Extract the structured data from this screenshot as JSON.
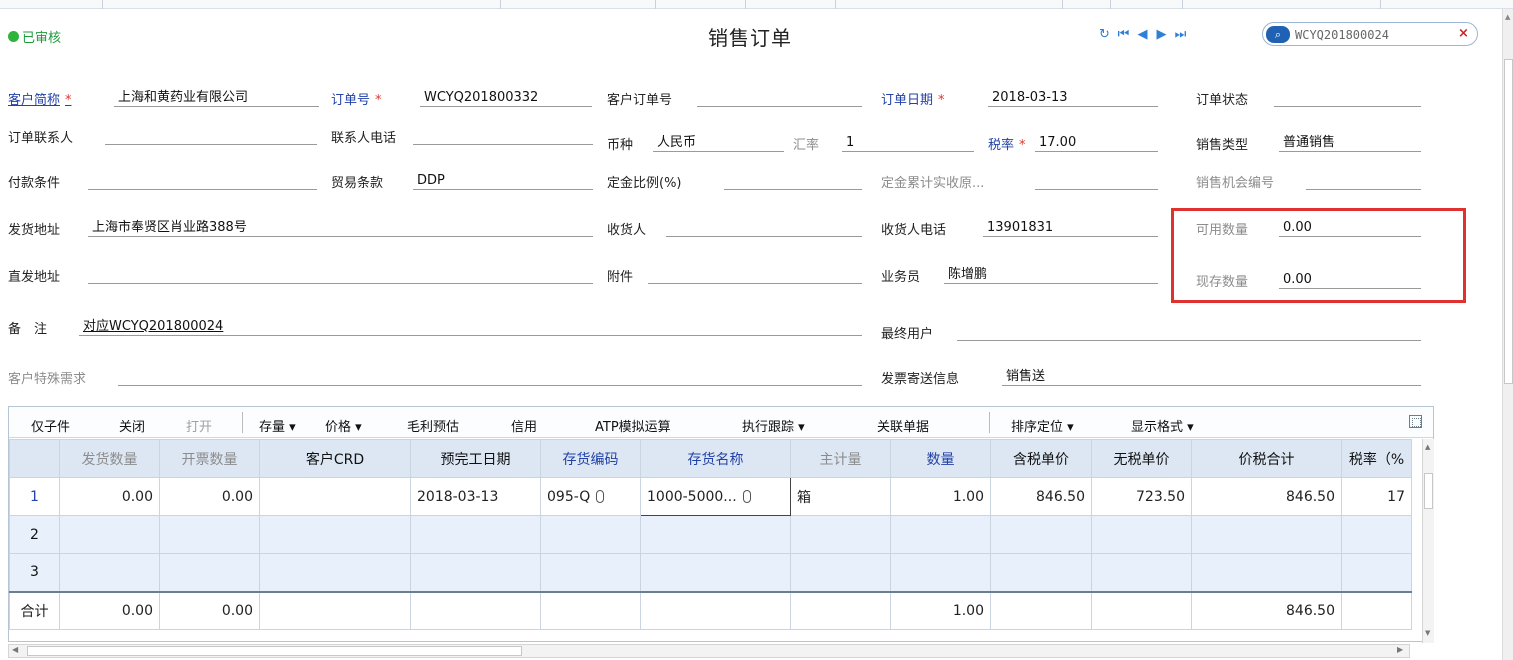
{
  "header": {
    "status": "已审核",
    "title": "销售订单",
    "search_value": "WCYQ201800024"
  },
  "form": {
    "customer_label": "客户简称",
    "customer": "上海和黄药业有限公司",
    "order_no_label": "订单号",
    "order_no": "WCYQ201800332",
    "cust_order_no_label": "客户订单号",
    "cust_order_no": "",
    "order_date_label": "订单日期",
    "order_date": "2018-03-13",
    "order_status_label": "订单状态",
    "order_status": "",
    "contact_label": "订单联系人",
    "contact": "",
    "contact_phone_label": "联系人电话",
    "contact_phone": "",
    "currency_label": "币种",
    "currency": "人民币",
    "rate_label": "汇率",
    "rate": "1",
    "tax_label": "税率",
    "tax": "17.00",
    "sales_type_label": "销售类型",
    "sales_type": "普通销售",
    "payment_label": "付款条件",
    "payment": "",
    "trade_label": "贸易条款",
    "trade": "DDP",
    "deposit_label": "定金比例(%)",
    "deposit": "",
    "deposit_total_label": "定金累计实收原...",
    "deposit_total": "",
    "opportunity_label": "销售机会编号",
    "opportunity": "",
    "ship_addr_label": "发货地址",
    "ship_addr": "上海市奉贤区肖业路388号",
    "receiver_label": "收货人",
    "receiver": "",
    "receiver_phone_label": "收货人电话",
    "receiver_phone": "13901831",
    "available_label": "可用数量",
    "available": "0.00",
    "direct_addr_label": "直发地址",
    "direct_addr": "",
    "attach_label": "附件",
    "attach": "",
    "salesman_label": "业务员",
    "salesman": "陈增鹏",
    "onhand_label": "现存数量",
    "onhand": "0.00",
    "remark_label": "备　注",
    "remark": "对应WCYQ201800024",
    "end_user_label": "最终用户",
    "end_user": "",
    "special_label": "客户特殊需求",
    "special": "",
    "invoice_label": "发票寄送信息",
    "invoice": "销售送"
  },
  "toolbar": {
    "child": "仅子件",
    "close": "关闭",
    "open": "打开",
    "stock": "存量 ▾",
    "price": "价格 ▾",
    "margin": "毛利预估",
    "credit": "信用",
    "atp": "ATP模拟运算",
    "track": "执行跟踪 ▾",
    "related": "关联单据",
    "sort": "排序定位 ▾",
    "format": "显示格式 ▾"
  },
  "grid": {
    "headers": [
      "",
      "发货数量",
      "开票数量",
      "客户CRD",
      "预完工日期",
      "存货编码",
      "存货名称",
      "主计量",
      "数量",
      "含税单价",
      "无税单价",
      "价税合计",
      "税率（%"
    ],
    "rows": [
      [
        "1",
        "0.00",
        "0.00",
        "",
        "2018-03-13",
        "095-Q",
        "1000-5000...",
        "箱",
        "1.00",
        "846.50",
        "723.50",
        "846.50",
        "17"
      ],
      [
        "2",
        "",
        "",
        "",
        "",
        "",
        "",
        "",
        "",
        "",
        "",
        "",
        ""
      ],
      [
        "3",
        "",
        "",
        "",
        "",
        "",
        "",
        "",
        "",
        "",
        "",
        "",
        ""
      ]
    ],
    "total": [
      "合计",
      "0.00",
      "0.00",
      "",
      "",
      "",
      "",
      "",
      "1.00",
      "",
      "",
      "846.50",
      ""
    ]
  },
  "colors": {
    "accent": "#2242a8",
    "required": "#e2342d",
    "approved": "#2fb33d",
    "highlight_box": "#e03131"
  }
}
